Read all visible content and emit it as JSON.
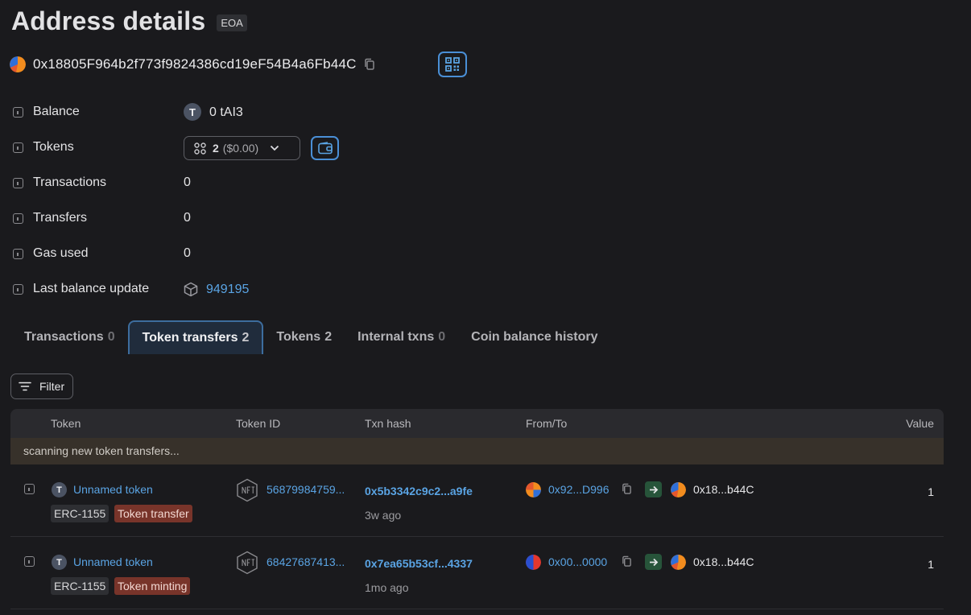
{
  "page": {
    "title": "Address details",
    "badge": "EOA",
    "address": "0x18805F964b2f773f9824386cd19eF54B4a6Fb44C"
  },
  "details": {
    "balance_label": "Balance",
    "balance_value": "0 tAI3",
    "coin_letter": "T",
    "tokens_label": "Tokens",
    "tokens_count": "2",
    "tokens_usd": "($0.00)",
    "transactions_label": "Transactions",
    "transactions_value": "0",
    "transfers_label": "Transfers",
    "transfers_value": "0",
    "gas_label": "Gas used",
    "gas_value": "0",
    "last_update_label": "Last balance update",
    "last_update_block": "949195"
  },
  "tabs": [
    {
      "label": "Transactions",
      "count": "0"
    },
    {
      "label": "Token transfers",
      "count": "2"
    },
    {
      "label": "Tokens",
      "count": "2"
    },
    {
      "label": "Internal txns",
      "count": "0"
    },
    {
      "label": "Coin balance history",
      "count": ""
    }
  ],
  "filter": {
    "label": "Filter"
  },
  "table": {
    "headers": {
      "token": "Token",
      "token_id": "Token ID",
      "txn_hash": "Txn hash",
      "from_to": "From/To",
      "value": "Value"
    },
    "scanning_text": "scanning new token transfers...",
    "rows": [
      {
        "coin_letter": "T",
        "token": "Unnamed token",
        "standard": "ERC-1155",
        "type": "Token transfer",
        "token_id": "56879984759...",
        "txn_hash": "0x5b3342c9c2...a9fe",
        "age": "3w ago",
        "from": "0x92...D996",
        "to": "0x18...b44C",
        "value": "1"
      },
      {
        "coin_letter": "T",
        "token": "Unnamed token",
        "standard": "ERC-1155",
        "type": "Token minting",
        "token_id": "68427687413...",
        "txn_hash": "0x7ea65b53cf...4337",
        "age": "1mo ago",
        "from": "0x00...0000",
        "to": "0x18...b44C",
        "value": "1"
      }
    ]
  },
  "icons": {
    "copy": "copy-icon",
    "qr": "qr-code-icon",
    "wallet": "wallet-icon",
    "cube": "block-cube-icon",
    "filter": "filter-icon",
    "nft": "nft-icon",
    "arrow": "arrow-right-icon",
    "chevron": "chevron-down-icon"
  },
  "colors": {
    "background": "#1a1a1d",
    "link": "#5aa4e4",
    "accent_border": "#4a8fd6",
    "type_badge": "#78342a",
    "in_arrow": "#27543a"
  }
}
